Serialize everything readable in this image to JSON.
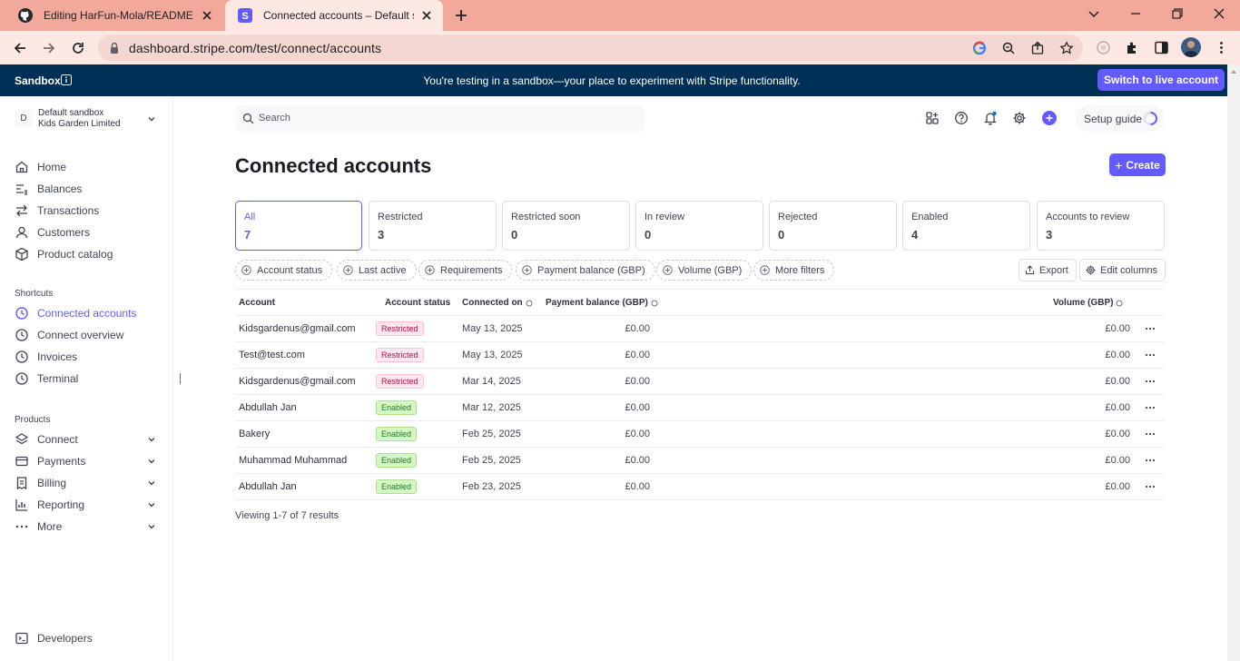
{
  "browser": {
    "tabs": [
      {
        "title": "Editing HarFun-Mola/README.m",
        "favicon": "github-icon"
      },
      {
        "title": "Connected accounts – Default sa",
        "favicon": "stripe-icon"
      }
    ],
    "url": "dashboard.stripe.com/test/connect/accounts"
  },
  "banner": {
    "label": "Sandbox",
    "message": "You're testing in a sandbox—your place to experiment with Stripe functionality.",
    "switch_label": "Switch to live account"
  },
  "account": {
    "initial": "D",
    "name": "Default sandbox",
    "company": "Kids Garden Limited"
  },
  "sidebar": {
    "main_items": [
      {
        "label": "Home",
        "icon": "home-icon"
      },
      {
        "label": "Balances",
        "icon": "balances-icon"
      },
      {
        "label": "Transactions",
        "icon": "transactions-icon"
      },
      {
        "label": "Customers",
        "icon": "customers-icon"
      },
      {
        "label": "Product catalog",
        "icon": "product-catalog-icon"
      }
    ],
    "shortcuts_label": "Shortcuts",
    "shortcuts": [
      {
        "label": "Connected accounts",
        "active": true
      },
      {
        "label": "Connect overview"
      },
      {
        "label": "Invoices"
      },
      {
        "label": "Terminal"
      }
    ],
    "products_label": "Products",
    "products": [
      {
        "label": "Connect",
        "icon": "connect-icon"
      },
      {
        "label": "Payments",
        "icon": "payments-icon"
      },
      {
        "label": "Billing",
        "icon": "billing-icon"
      },
      {
        "label": "Reporting",
        "icon": "reporting-icon"
      },
      {
        "label": "More",
        "icon": "more-icon"
      }
    ],
    "developers_label": "Developers"
  },
  "header": {
    "search_placeholder": "Search",
    "setup_guide": "Setup guide"
  },
  "main": {
    "title": "Connected accounts",
    "create_label": "Create",
    "status_cards": [
      {
        "label": "All",
        "count": "7",
        "active": true
      },
      {
        "label": "Restricted",
        "count": "3"
      },
      {
        "label": "Restricted soon",
        "count": "0"
      },
      {
        "label": "In review",
        "count": "0"
      },
      {
        "label": "Rejected",
        "count": "0"
      },
      {
        "label": "Enabled",
        "count": "4"
      },
      {
        "label": "Accounts to review",
        "count": "3"
      }
    ],
    "filters": [
      "Account status",
      "Last active",
      "Requirements",
      "Payment balance (GBP)",
      "Volume (GBP)",
      "More filters"
    ],
    "export_label": "Export",
    "edit_columns_label": "Edit columns",
    "columns": {
      "account": "Account",
      "status": "Account status",
      "connected": "Connected on",
      "payment_balance": "Payment balance (GBP)",
      "volume": "Volume (GBP)"
    },
    "rows": [
      {
        "account": "Kidsgardenus@gmail.com",
        "status": "Restricted",
        "connected": "May 13, 2025",
        "payment_balance": "£0.00",
        "volume": "£0.00"
      },
      {
        "account": "Test@test.com",
        "status": "Restricted",
        "connected": "May 13, 2025",
        "payment_balance": "£0.00",
        "volume": "£0.00"
      },
      {
        "account": "Kidsgardenus@gmail.com",
        "status": "Restricted",
        "connected": "Mar 14, 2025",
        "payment_balance": "£0.00",
        "volume": "£0.00"
      },
      {
        "account": "Abdullah Jan",
        "status": "Enabled",
        "connected": "Mar 12, 2025",
        "payment_balance": "£0.00",
        "volume": "£0.00"
      },
      {
        "account": "Bakery",
        "status": "Enabled",
        "connected": "Feb 25, 2025",
        "payment_balance": "£0.00",
        "volume": "£0.00"
      },
      {
        "account": "Muhammad Muhammad",
        "status": "Enabled",
        "connected": "Feb 25, 2025",
        "payment_balance": "£0.00",
        "volume": "£0.00"
      },
      {
        "account": "Abdullah Jan",
        "status": "Enabled",
        "connected": "Feb 23, 2025",
        "payment_balance": "£0.00",
        "volume": "£0.00"
      }
    ],
    "results_text": "Viewing 1-7 of 7 results"
  },
  "colors": {
    "accent": "#635bff",
    "banner_bg": "#003055",
    "tabbar_bg": "#f2a99b",
    "restricted": "#c0123c",
    "enabled": "#1b7b2e"
  }
}
